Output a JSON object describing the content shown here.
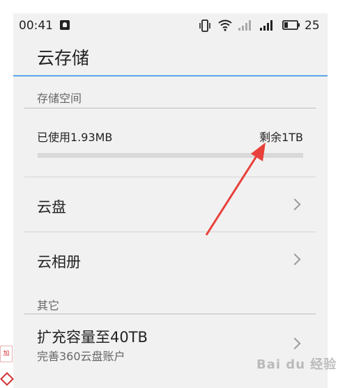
{
  "status_bar": {
    "time": "00:41",
    "battery_level": "25",
    "icons": [
      "notification-icon",
      "vibrate-icon",
      "wifi-icon",
      "signal-icon",
      "signal-icon",
      "battery-icon"
    ]
  },
  "header": {
    "title": "云存储"
  },
  "storage": {
    "section_title": "存储空间",
    "used_label": "已使用1.93MB",
    "remaining_label": "剩余1TB",
    "used_fraction": 0.0
  },
  "menu": [
    {
      "label": "云盘"
    },
    {
      "label": "云相册"
    }
  ],
  "other": {
    "section_title": "其它",
    "expand_label": "扩充容量至40TB",
    "expand_sub": "完善360云盘账户"
  },
  "overlay": {
    "side_tag": "加速",
    "watermark": "Bai du 经验"
  },
  "colors": {
    "accent": "#5aa6e8",
    "annotation_arrow": "#e8403a",
    "background": "#f1f1f1"
  }
}
